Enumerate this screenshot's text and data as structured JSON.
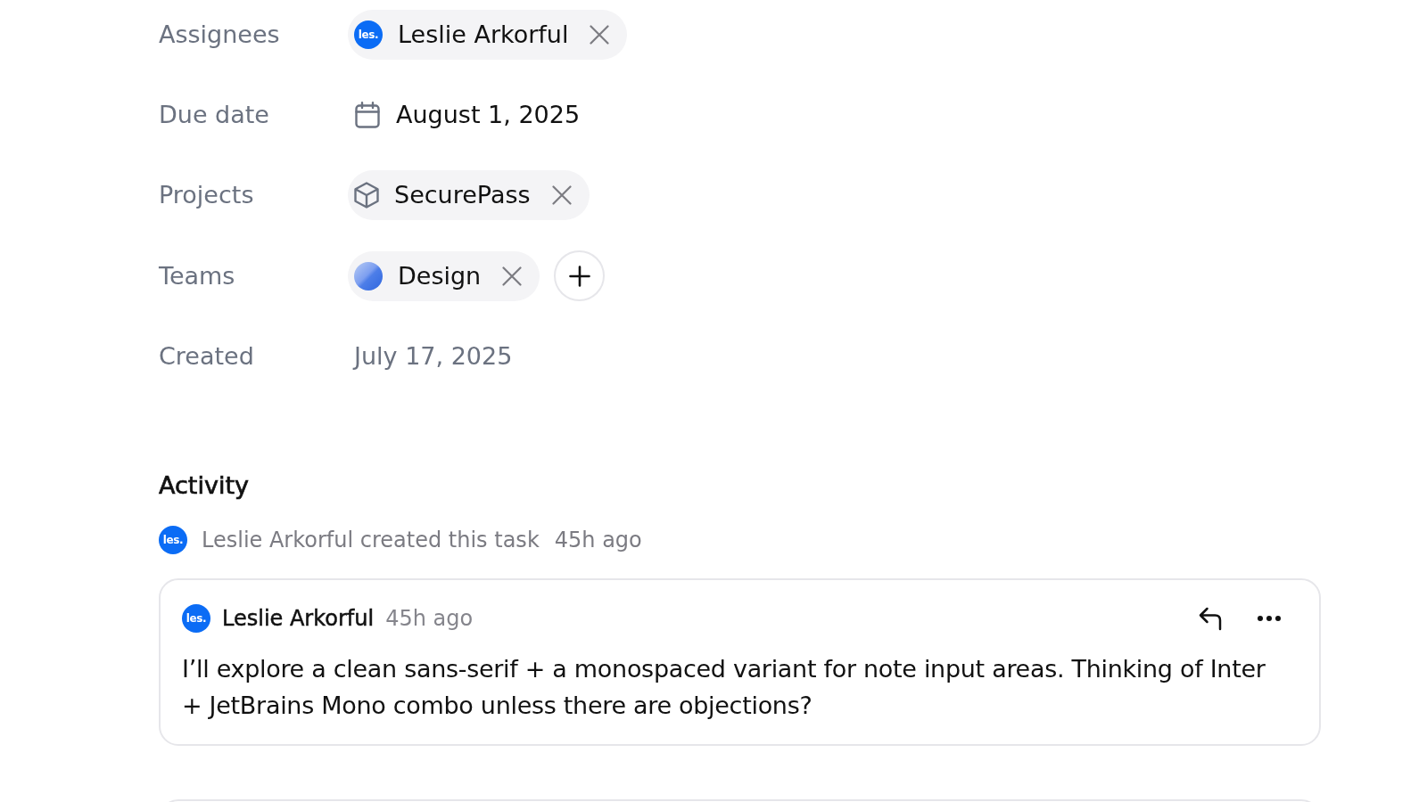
{
  "properties": [
    {
      "label": "Assignees",
      "kind": "people",
      "chips": [
        {
          "avatar": "les.",
          "name": "Leslie Arkorful",
          "removable": true
        }
      ]
    },
    {
      "label": "Due date",
      "kind": "date",
      "value": "August 1, 2025"
    },
    {
      "label": "Projects",
      "kind": "project",
      "chips": [
        {
          "name": "SecurePass",
          "removable": true
        }
      ]
    },
    {
      "label": "Teams",
      "kind": "team",
      "chips": [
        {
          "name": "Design",
          "removable": true
        }
      ]
    },
    {
      "label": "Created",
      "kind": "text",
      "value": "July 17, 2025"
    }
  ],
  "activity": {
    "title": "Activity",
    "events": [
      {
        "avatar": "les.",
        "text": "Leslie Arkorful created this task",
        "time": "45h ago"
      }
    ],
    "comments": [
      {
        "avatar": "les.",
        "author": "Leslie Arkorful",
        "time": "45h ago",
        "body": "I’ll explore a clean sans-serif + a monospaced variant for note input areas. Thinking of Inter + JetBrains Mono combo unless there are objections?"
      }
    ]
  }
}
